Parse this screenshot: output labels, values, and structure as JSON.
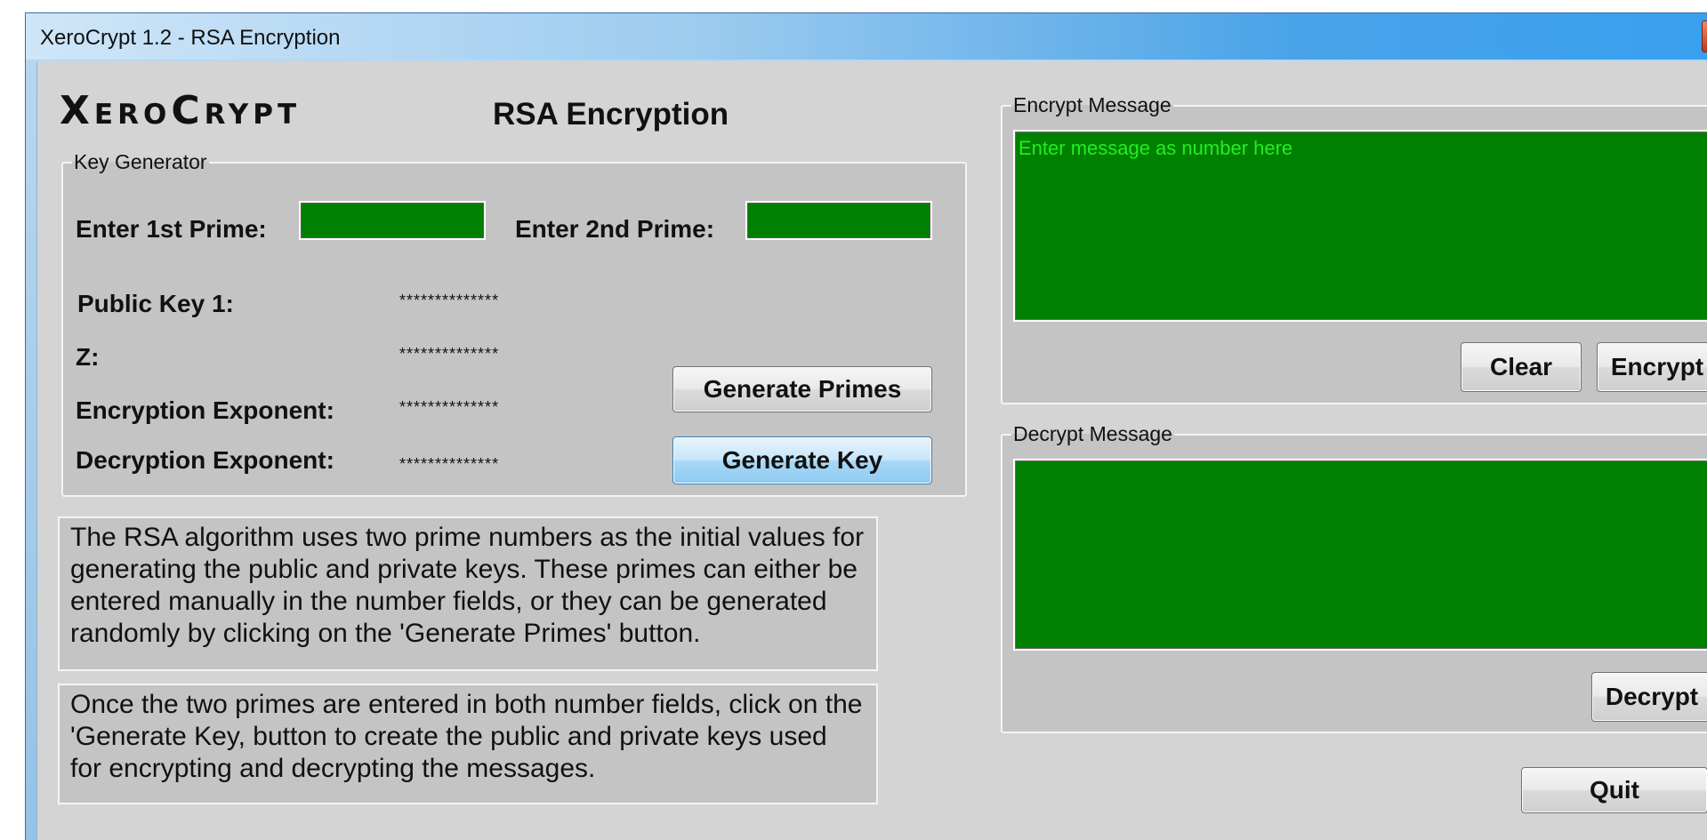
{
  "window": {
    "title": "XeroCrypt 1.2 - RSA Encryption"
  },
  "header": {
    "logo": "XeroCrypt",
    "subtitle": "RSA Encryption"
  },
  "key_generator": {
    "legend": "Key Generator",
    "prime1_label": "Enter 1st Prime:",
    "prime1_value": "",
    "prime2_label": "Enter 2nd Prime:",
    "prime2_value": "",
    "public_key_label": "Public Key 1:",
    "public_key_value": "**************",
    "z_label": "Z:",
    "z_value": "**************",
    "enc_exp_label": "Encryption Exponent:",
    "enc_exp_value": "**************",
    "dec_exp_label": "Decryption Exponent:",
    "dec_exp_value": "**************",
    "generate_primes_label": "Generate Primes",
    "generate_key_label": "Generate Key"
  },
  "info": {
    "text1": "The RSA algorithm uses two prime numbers as the initial values for generating the public and private keys. These primes can either be entered manually in the number fields, or they can be generated randomly by clicking on the 'Generate Primes' button.",
    "text2": "Once the two primes are entered in both number fields, click on the 'Generate Key, button to create the public and private keys used for encrypting and decrypting the messages."
  },
  "encrypt": {
    "legend": "Encrypt Message",
    "placeholder": "Enter message as number here",
    "clear_label": "Clear",
    "encrypt_label": "Encrypt"
  },
  "decrypt": {
    "legend": "Decrypt Message",
    "value": "",
    "decrypt_label": "Decrypt"
  },
  "footer": {
    "quit_label": "Quit"
  },
  "colors": {
    "field_green": "#008000",
    "placeholder_green": "#22ee22"
  }
}
